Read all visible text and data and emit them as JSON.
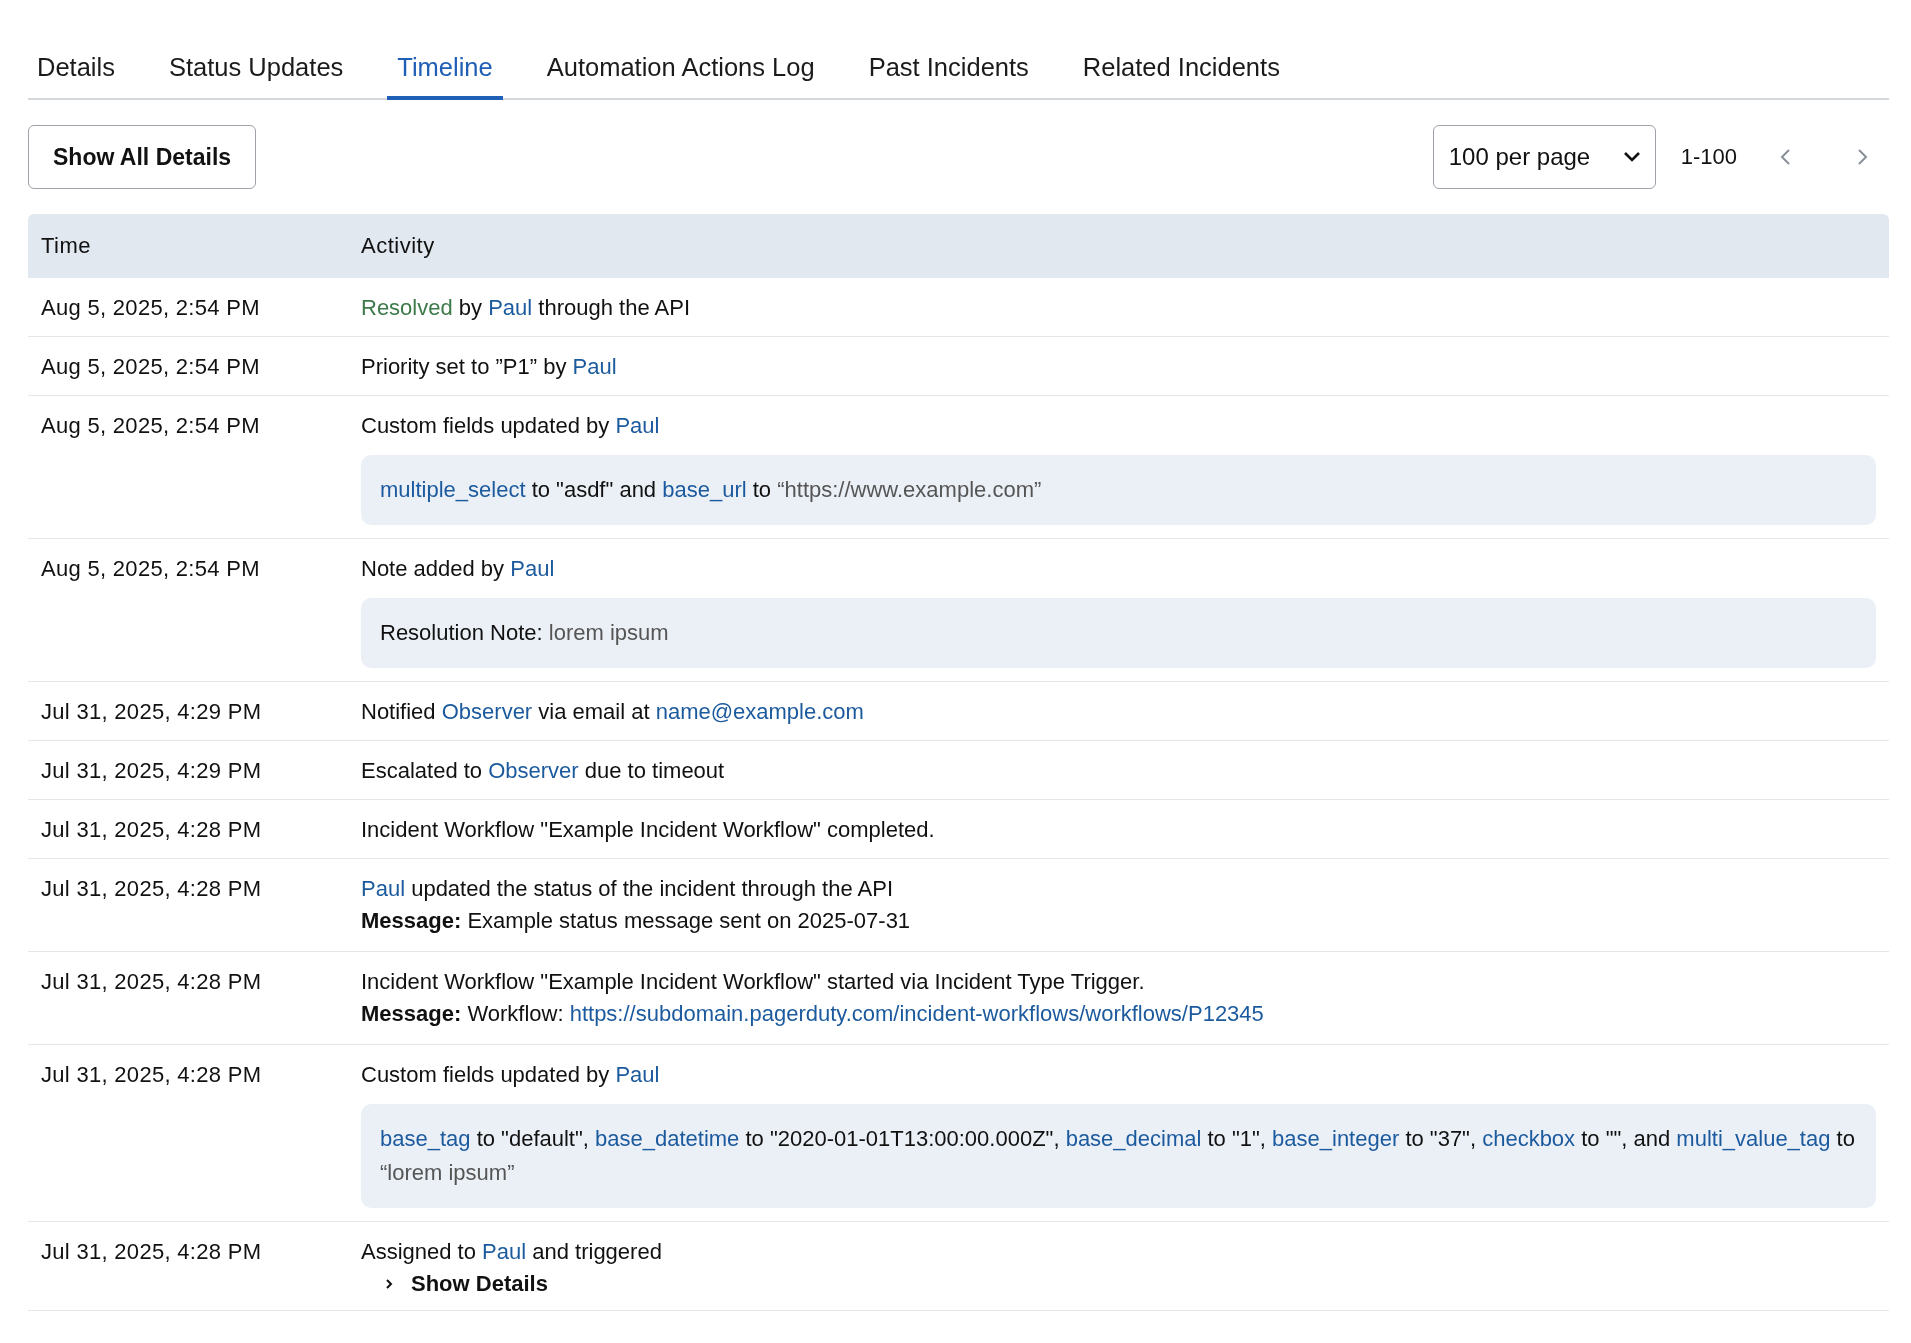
{
  "tabs": [
    {
      "label": "Details",
      "selected": false
    },
    {
      "label": "Status Updates",
      "selected": false
    },
    {
      "label": "Timeline",
      "selected": true
    },
    {
      "label": "Automation Actions Log",
      "selected": false
    },
    {
      "label": "Past Incidents",
      "selected": false
    },
    {
      "label": "Related Incidents",
      "selected": false
    }
  ],
  "toolbar": {
    "show_all_button": "Show All Details",
    "per_page": "100 per page",
    "range": "1-100"
  },
  "table": {
    "columns": [
      "Time",
      "Activity"
    ],
    "rows": [
      {
        "time": "Aug 5, 2025, 2:54 PM",
        "lines": [
          [
            {
              "kind": "status",
              "text": "Resolved"
            },
            {
              "kind": "text",
              "text": " by "
            },
            {
              "kind": "link",
              "text": "Paul"
            },
            {
              "kind": "text",
              "text": " through the API"
            }
          ]
        ]
      },
      {
        "time": "Aug 5, 2025, 2:54 PM",
        "lines": [
          [
            {
              "kind": "text",
              "text": "Priority set to ”P1” by "
            },
            {
              "kind": "link",
              "text": "Paul"
            }
          ]
        ]
      },
      {
        "time": "Aug 5, 2025, 2:54 PM",
        "lines": [
          [
            {
              "kind": "text",
              "text": "Custom fields updated by "
            },
            {
              "kind": "link",
              "text": "Paul"
            }
          ]
        ],
        "detail_box": [
          {
            "kind": "link",
            "text": "multiple_select"
          },
          {
            "kind": "text",
            "text": " to \"asdf\" and "
          },
          {
            "kind": "link",
            "text": "base_url"
          },
          {
            "kind": "text",
            "text": " to "
          },
          {
            "kind": "value",
            "text": "“https://www.example.com”"
          }
        ]
      },
      {
        "time": "Aug 5, 2025, 2:54 PM",
        "lines": [
          [
            {
              "kind": "text",
              "text": "Note added by "
            },
            {
              "kind": "link",
              "text": "Paul"
            }
          ]
        ],
        "detail_box": [
          {
            "kind": "text",
            "text": "Resolution Note: "
          },
          {
            "kind": "value",
            "text": "lorem ipsum"
          }
        ]
      },
      {
        "time": "Jul 31, 2025, 4:29 PM",
        "lines": [
          [
            {
              "kind": "text",
              "text": "Notified "
            },
            {
              "kind": "link",
              "text": "Observer"
            },
            {
              "kind": "text",
              "text": " via email at "
            },
            {
              "kind": "link",
              "text": "name@example.com"
            }
          ]
        ]
      },
      {
        "time": "Jul 31, 2025, 4:29 PM",
        "lines": [
          [
            {
              "kind": "text",
              "text": "Escalated to "
            },
            {
              "kind": "link",
              "text": "Observer"
            },
            {
              "kind": "text",
              "text": " due to timeout"
            }
          ]
        ]
      },
      {
        "time": "Jul 31, 2025, 4:28 PM",
        "lines": [
          [
            {
              "kind": "text",
              "text": "Incident Workflow \"Example Incident Workflow\" completed."
            }
          ]
        ]
      },
      {
        "time": "Jul 31, 2025, 4:28 PM",
        "lines": [
          [
            {
              "kind": "link",
              "text": "Paul"
            },
            {
              "kind": "text",
              "text": " updated the status of the incident through the API"
            }
          ],
          [
            {
              "kind": "bold",
              "text": "Message:"
            },
            {
              "kind": "text",
              "text": " Example status message sent on 2025-07-31"
            }
          ]
        ]
      },
      {
        "time": "Jul 31, 2025, 4:28 PM",
        "lines": [
          [
            {
              "kind": "text",
              "text": "Incident Workflow \"Example Incident Workflow\" started via Incident Type Trigger."
            }
          ],
          [
            {
              "kind": "bold",
              "text": "Message:"
            },
            {
              "kind": "text",
              "text": " Workflow: "
            },
            {
              "kind": "link",
              "text": "https://subdomain.pagerduty.com/incident-workflows/workflows/P12345"
            }
          ]
        ]
      },
      {
        "time": "Jul 31, 2025, 4:28 PM",
        "lines": [
          [
            {
              "kind": "text",
              "text": "Custom fields updated by "
            },
            {
              "kind": "link",
              "text": "Paul"
            }
          ]
        ],
        "detail_box": [
          {
            "kind": "link",
            "text": "base_tag"
          },
          {
            "kind": "text",
            "text": " to \"default\", "
          },
          {
            "kind": "link",
            "text": "base_datetime"
          },
          {
            "kind": "text",
            "text": " to \"2020-01-01T13:00:00.000Z\", "
          },
          {
            "kind": "link",
            "text": "base_decimal"
          },
          {
            "kind": "text",
            "text": " to \"1\", "
          },
          {
            "kind": "link",
            "text": "base_integer"
          },
          {
            "kind": "text",
            "text": " to \"37\", "
          },
          {
            "kind": "link",
            "text": "checkbox"
          },
          {
            "kind": "text",
            "text": " to \"\", and "
          },
          {
            "kind": "link",
            "text": "multi_value_tag"
          },
          {
            "kind": "text",
            "text": " to "
          },
          {
            "kind": "value",
            "text": "“lorem ipsum”"
          }
        ]
      },
      {
        "time": "Jul 31, 2025, 4:28 PM",
        "lines": [
          [
            {
              "kind": "text",
              "text": "Assigned to "
            },
            {
              "kind": "link",
              "text": "Paul"
            },
            {
              "kind": "text",
              "text": " and triggered"
            }
          ]
        ],
        "show_details": {
          "label": "Show Details",
          "expanded": false
        }
      }
    ]
  }
}
